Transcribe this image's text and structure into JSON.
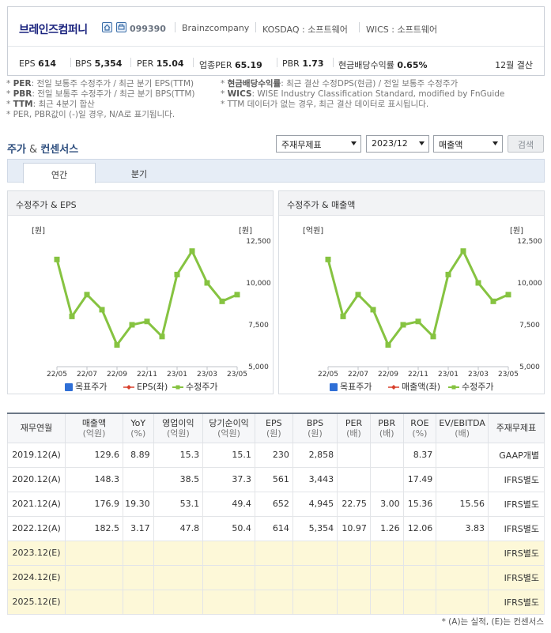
{
  "company": {
    "name": "브레인즈컴퍼니",
    "code": "099390",
    "english_name": "Brainzcompany",
    "market": "KOSDAQ : 소프트웨어",
    "wics": "WICS : 소프트웨어",
    "icons": [
      "home-icon",
      "print-icon"
    ]
  },
  "stats": [
    {
      "label": "EPS",
      "value": "614"
    },
    {
      "label": "BPS",
      "value": "5,354"
    },
    {
      "label": "PER",
      "value": "15.04"
    },
    {
      "label": "업종PER",
      "value": "65.19"
    },
    {
      "label": "PBR",
      "value": "1.73"
    },
    {
      "label": "현금배당수익률",
      "value": "0.65%"
    }
  ],
  "settlement": "12월 결산",
  "notes_left": [
    {
      "key": "PER",
      "text": ": 전일 보통주 수정주가 / 최근 분기 EPS(TTM)"
    },
    {
      "key": "PBR",
      "text": ": 전일 보통주 수정주가 / 최근 분기 BPS(TTM)"
    },
    {
      "key": "TTM",
      "text": ": 최근 4분기 합산"
    },
    {
      "key": "",
      "text": "PER, PBR값이 (-)일 경우, N/A로 표기됩니다."
    }
  ],
  "notes_right": [
    {
      "key": "현금배당수익률",
      "text": ": 최근 결산 수정DPS(현금) / 전일 보통주 수정주가"
    },
    {
      "key": "WICS",
      "text": ": WISE Industry Classification Standard, modified by FnGuide"
    },
    {
      "key": "",
      "text": "TTM 데이터가 없는 경우, 최근 결산 데이터로 표시됩니다."
    }
  ],
  "section": {
    "title_a": "주가",
    "amp": " & ",
    "title_b": "컨센서스"
  },
  "filters": {
    "statement": "주재무제표",
    "period": "2023/12",
    "metric": "매출액",
    "search_label": "검색"
  },
  "tabs": [
    {
      "label": "연간",
      "active": true
    },
    {
      "label": "분기",
      "active": false
    }
  ],
  "charts": [
    {
      "title": "수정주가 & EPS",
      "left_unit": "[원]",
      "right_unit": "[원]",
      "legend": [
        "목표주가",
        "EPS(좌)",
        "수정주가"
      ]
    },
    {
      "title": "수정주가 & 매출액",
      "left_unit": "[억원]",
      "right_unit": "[원]",
      "legend": [
        "목표주가",
        "매출액(좌)",
        "수정주가"
      ]
    }
  ],
  "chart_data": [
    {
      "type": "line",
      "title": "수정주가 & EPS",
      "x_ticks": [
        "22/05",
        "22/07",
        "22/09",
        "22/11",
        "23/01",
        "23/03",
        "23/05"
      ],
      "y_right_ticks": [
        "12,500",
        "10,000",
        "7,500",
        "5,000"
      ],
      "y_right_range": [
        5000,
        12500
      ],
      "series": [
        {
          "name": "수정주가",
          "color": "#86c341",
          "values": [
            11400,
            8000,
            9300,
            8400,
            6300,
            7500,
            7700,
            6800,
            10500,
            11900,
            10000,
            8900,
            9300
          ]
        }
      ]
    },
    {
      "type": "line",
      "title": "수정주가 & 매출액",
      "x_ticks": [
        "22/05",
        "22/07",
        "22/09",
        "22/11",
        "23/01",
        "23/03",
        "23/05"
      ],
      "y_right_ticks": [
        "12,500",
        "10,000",
        "7,500",
        "5,000"
      ],
      "y_right_range": [
        5000,
        12500
      ],
      "series": [
        {
          "name": "수정주가",
          "color": "#86c341",
          "values": [
            11400,
            8000,
            9300,
            8400,
            6300,
            7500,
            7700,
            6800,
            10500,
            11900,
            10000,
            8900,
            9300
          ]
        }
      ]
    }
  ],
  "legend_colors": {
    "target": "#2f6fd6",
    "eps": "#d8402c",
    "price": "#86c341"
  },
  "table": {
    "headers": [
      {
        "t": "재무연월",
        "u": ""
      },
      {
        "t": "매출액",
        "u": "(억원)"
      },
      {
        "t": "YoY",
        "u": "(%)"
      },
      {
        "t": "영업이익",
        "u": "(억원)"
      },
      {
        "t": "당기순이익",
        "u": "(억원)"
      },
      {
        "t": "EPS",
        "u": "(원)"
      },
      {
        "t": "BPS",
        "u": "(원)"
      },
      {
        "t": "PER",
        "u": "(배)"
      },
      {
        "t": "PBR",
        "u": "(배)"
      },
      {
        "t": "ROE",
        "u": "(%)"
      },
      {
        "t": "EV/EBITDA",
        "u": "(배)"
      },
      {
        "t": "주재무제표",
        "u": ""
      }
    ],
    "rows": [
      {
        "est": false,
        "cells": [
          "2019.12(A)",
          "129.6",
          "8.89",
          "15.3",
          "15.1",
          "230",
          "2,858",
          "",
          "",
          "8.37",
          "",
          "GAAP개별"
        ]
      },
      {
        "est": false,
        "cells": [
          "2020.12(A)",
          "148.3",
          "",
          "38.5",
          "37.3",
          "561",
          "3,443",
          "",
          "",
          "17.49",
          "",
          "IFRS별도"
        ]
      },
      {
        "est": false,
        "cells": [
          "2021.12(A)",
          "176.9",
          "19.30",
          "53.1",
          "49.4",
          "652",
          "4,945",
          "22.75",
          "3.00",
          "15.36",
          "15.56",
          "IFRS별도"
        ]
      },
      {
        "est": false,
        "cells": [
          "2022.12(A)",
          "182.5",
          "3.17",
          "47.8",
          "50.4",
          "614",
          "5,354",
          "10.97",
          "1.26",
          "12.06",
          "3.83",
          "IFRS별도"
        ]
      },
      {
        "est": true,
        "cells": [
          "2023.12(E)",
          "",
          "",
          "",
          "",
          "",
          "",
          "",
          "",
          "",
          "",
          "IFRS별도"
        ]
      },
      {
        "est": true,
        "cells": [
          "2024.12(E)",
          "",
          "",
          "",
          "",
          "",
          "",
          "",
          "",
          "",
          "",
          "IFRS별도"
        ]
      },
      {
        "est": true,
        "cells": [
          "2025.12(E)",
          "",
          "",
          "",
          "",
          "",
          "",
          "",
          "",
          "",
          "",
          "IFRS별도"
        ]
      }
    ]
  },
  "footnote": "* (A)는 실적, (E)는 컨센서스"
}
